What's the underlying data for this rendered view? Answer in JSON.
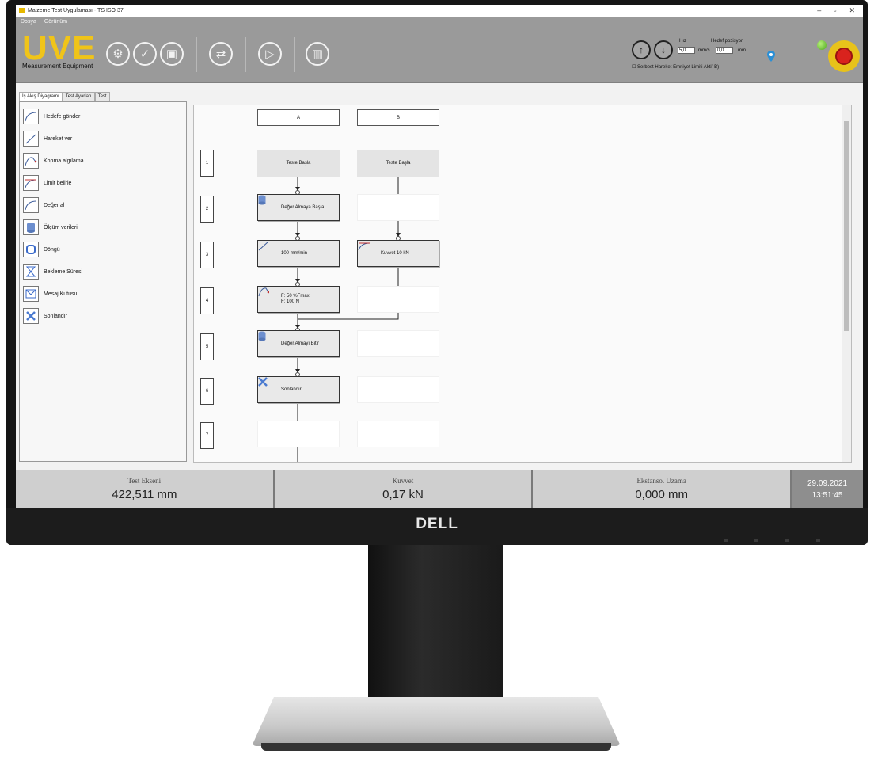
{
  "window": {
    "title": "Malzeme Test Uygulaması - TS ISO 37",
    "controls": [
      "–",
      "▫",
      "✕"
    ]
  },
  "menu": [
    "Dosya",
    "Görünüm"
  ],
  "logo": {
    "main": "UVE",
    "sub": "Measurement Equipment"
  },
  "motion": {
    "speed_label": "Hız",
    "speed_value": "5,0",
    "speed_unit": "mm/s",
    "target_label": "Hedef pozisyon",
    "target_value": "0,0",
    "target_unit": "mm",
    "safety_checkbox": "Serbest Hareket Emniyet Limiti Aktif B)"
  },
  "tabs": [
    "İş Akış Diyagramı",
    "Test Ayarları",
    "Test"
  ],
  "palette": [
    {
      "label": "Hedefe gönder",
      "icon": "curve-icon"
    },
    {
      "label": "Hareket ver",
      "icon": "line-icon"
    },
    {
      "label": "Kopma algılama",
      "icon": "break-curve-icon"
    },
    {
      "label": "Limit belirle",
      "icon": "limit-curve-icon"
    },
    {
      "label": "Değer al",
      "icon": "curve-icon"
    },
    {
      "label": "Ölçüm verileri",
      "icon": "database-icon"
    },
    {
      "label": "Döngü",
      "icon": "loop-icon"
    },
    {
      "label": "Bekleme Süresi",
      "icon": "hourglass-icon"
    },
    {
      "label": "Mesaj Kutusu",
      "icon": "mail-icon"
    },
    {
      "label": "Sonlandır",
      "icon": "close-icon"
    }
  ],
  "flow": {
    "columns": [
      "A",
      "B"
    ],
    "rows": [
      "1",
      "2",
      "3",
      "4",
      "5",
      "6",
      "7"
    ],
    "col_a": {
      "start": "Teste Başla",
      "r2": "Değer Almaya Başla",
      "r3": "100 mm/min",
      "r4_line1": "F: 50 %Fmax",
      "r4_line2": "F: 100 N",
      "r5": "Değer Almayı Bitir",
      "r6": "Sonlandır"
    },
    "col_b": {
      "start": "Teste Başla",
      "r3": "Kuvvet 10 kN"
    }
  },
  "status": [
    {
      "label": "Test Ekseni",
      "value": "422,511 mm"
    },
    {
      "label": "Kuvvet",
      "value": "0,17 kN"
    },
    {
      "label": "Ekstanso. Uzama",
      "value": "0,000 mm"
    }
  ],
  "datetime": {
    "date": "29.09.2021",
    "time": "13:51:45"
  },
  "monitor_brand": "DELL",
  "colors": {
    "logo": "#f0c419",
    "toolbar": "#9a9a9a",
    "status_date": "#8e8e8e",
    "estop": "#d9231d"
  }
}
